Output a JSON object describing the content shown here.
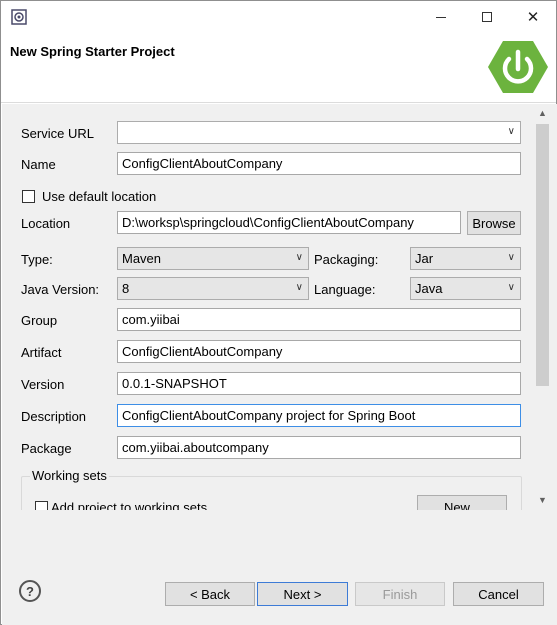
{
  "window": {
    "title": "New Spring Starter Project",
    "controls": {
      "minimize": "minimize",
      "maximize": "maximize",
      "close": "✕"
    }
  },
  "form": {
    "service_url": {
      "label": "Service URL",
      "value": ""
    },
    "name": {
      "label": "Name",
      "value": "ConfigClientAboutCompany"
    },
    "use_default_location": {
      "label": "Use default location",
      "checked": false
    },
    "location": {
      "label": "Location",
      "value": "D:\\worksp\\springcloud\\ConfigClientAboutCompany",
      "browse": "Browse"
    },
    "type": {
      "label": "Type:",
      "value": "Maven"
    },
    "packaging": {
      "label": "Packaging:",
      "value": "Jar"
    },
    "java_version": {
      "label": "Java Version:",
      "value": "8"
    },
    "language": {
      "label": "Language:",
      "value": "Java"
    },
    "group": {
      "label": "Group",
      "value": "com.yiibai"
    },
    "artifact": {
      "label": "Artifact",
      "value": "ConfigClientAboutCompany"
    },
    "version": {
      "label": "Version",
      "value": "0.0.1-SNAPSHOT"
    },
    "description": {
      "label": "Description",
      "value": "ConfigClientAboutCompany project for Spring Boot"
    },
    "package": {
      "label": "Package",
      "value": "com.yiibai.aboutcompany"
    },
    "working_sets": {
      "title": "Working sets",
      "add_label": "Add project to working sets",
      "new_button": "New..."
    }
  },
  "footer": {
    "help": "?",
    "back": "< Back",
    "next": "Next >",
    "finish": "Finish",
    "cancel": "Cancel"
  },
  "icons": [
    "app-icon",
    "spring-logo-icon",
    "help-icon",
    "chevron-down-icon"
  ],
  "colors": {
    "spring_green": "#6cb33e",
    "focus_border": "#3d8ee6",
    "dialog_bg": "#f0f0f0"
  }
}
